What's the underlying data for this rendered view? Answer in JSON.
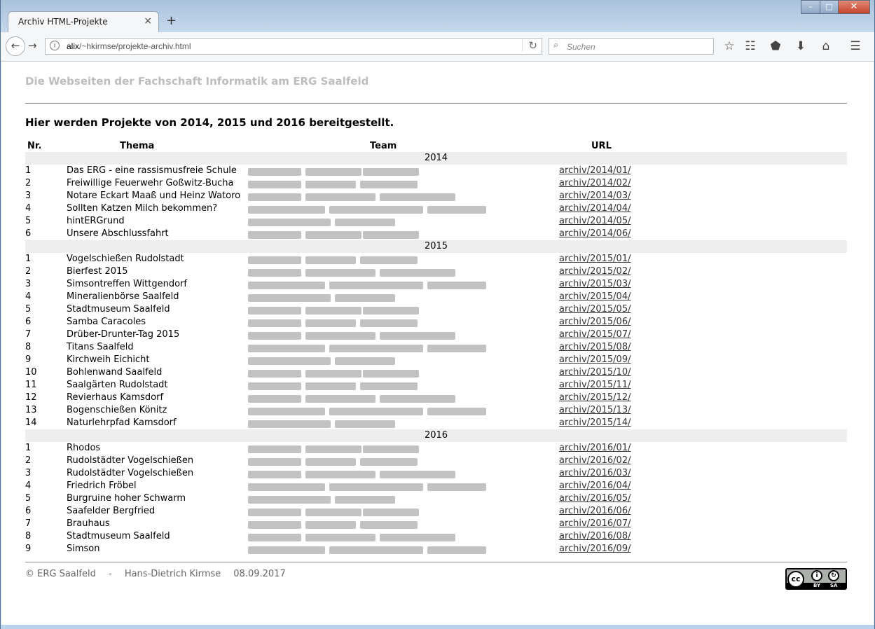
{
  "browser": {
    "tab_title": "Archiv HTML-Projekte",
    "tab_close": "×",
    "new_tab": "+",
    "url_host": "alix",
    "url_path": "/~hkirmse/projekte-archiv.html",
    "search_placeholder": "Suchen",
    "window_controls": {
      "minimize": "–",
      "maximize": "□",
      "close": "✕"
    },
    "toolbar_icons": [
      "bookmark-star-icon",
      "reader-view-icon",
      "pocket-icon",
      "downloads-icon",
      "home-icon",
      "menu-icon"
    ]
  },
  "page": {
    "site_title": "Die Webseiten der Fachschaft Informatik am ERG Saalfeld",
    "heading": "Hier werden Projekte von 2014, 2015 und 2016 bereitgestellt.",
    "columns": {
      "nr": "Nr.",
      "thema": "Thema",
      "team": "Team",
      "url": "URL"
    },
    "years": [
      {
        "year": "2014",
        "rows": [
          {
            "nr": "1",
            "thema": "Das ERG - eine rassismusfreie Schule",
            "url": "archiv/2014/01/"
          },
          {
            "nr": "2",
            "thema": "Freiwillige Feuerwehr Goßwitz-Bucha",
            "url": "archiv/2014/02/"
          },
          {
            "nr": "3",
            "thema": "Notare Eckart Maaß und Heinz Watoro",
            "url": "archiv/2014/03/"
          },
          {
            "nr": "4",
            "thema": "Sollten Katzen Milch bekommen?",
            "url": "archiv/2014/04/"
          },
          {
            "nr": "5",
            "thema": "hintERGrund",
            "url": "archiv/2014/05/"
          },
          {
            "nr": "6",
            "thema": "Unsere Abschlussfahrt",
            "url": "archiv/2014/06/"
          }
        ]
      },
      {
        "year": "2015",
        "rows": [
          {
            "nr": "1",
            "thema": "Vogelschießen Rudolstadt",
            "url": "archiv/2015/01/"
          },
          {
            "nr": "2",
            "thema": "Bierfest 2015",
            "url": "archiv/2015/02/"
          },
          {
            "nr": "3",
            "thema": "Simsontreffen Wittgendorf",
            "url": "archiv/2015/03/"
          },
          {
            "nr": "4",
            "thema": "Mineralienbörse Saalfeld",
            "url": "archiv/2015/04/"
          },
          {
            "nr": "5",
            "thema": "Stadtmuseum Saalfeld",
            "url": "archiv/2015/05/"
          },
          {
            "nr": "6",
            "thema": "Samba Caracoles",
            "url": "archiv/2015/06/"
          },
          {
            "nr": "7",
            "thema": "Drüber-Drunter-Tag 2015",
            "url": "archiv/2015/07/"
          },
          {
            "nr": "8",
            "thema": "Titans Saalfeld",
            "url": "archiv/2015/08/"
          },
          {
            "nr": "9",
            "thema": "Kirchweih Eichicht",
            "url": "archiv/2015/09/"
          },
          {
            "nr": "10",
            "thema": "Bohlenwand Saalfeld",
            "url": "archiv/2015/10/"
          },
          {
            "nr": "11",
            "thema": "Saalgärten Rudolstadt",
            "url": "archiv/2015/11/"
          },
          {
            "nr": "12",
            "thema": "Revierhaus Kamsdorf",
            "url": "archiv/2015/12/"
          },
          {
            "nr": "13",
            "thema": "Bogenschießen Könitz",
            "url": "archiv/2015/13/"
          },
          {
            "nr": "14",
            "thema": "Naturlehrpfad Kamsdorf",
            "url": "archiv/2015/14/"
          }
        ]
      },
      {
        "year": "2016",
        "rows": [
          {
            "nr": "1",
            "thema": "Rhodos",
            "url": "archiv/2016/01/"
          },
          {
            "nr": "2",
            "thema": "Rudolstädter Vogelschießen",
            "url": "archiv/2016/02/"
          },
          {
            "nr": "3",
            "thema": "Rudolstädter Vogelschießen",
            "url": "archiv/2016/03/"
          },
          {
            "nr": "4",
            "thema": "Friedrich Fröbel",
            "url": "archiv/2016/04/"
          },
          {
            "nr": "5",
            "thema": "Burgruine hoher Schwarm",
            "url": "archiv/2016/05/"
          },
          {
            "nr": "6",
            "thema": "Saafelder Bergfried",
            "url": "archiv/2016/06/"
          },
          {
            "nr": "7",
            "thema": "Brauhaus",
            "url": "archiv/2016/07/"
          },
          {
            "nr": "8",
            "thema": "Stadtmuseum Saalfeld",
            "url": "archiv/2016/08/"
          },
          {
            "nr": "9",
            "thema": "Simson",
            "url": "archiv/2016/09/"
          }
        ]
      }
    ],
    "footer": {
      "copyright": "© ERG Saalfeld",
      "separator": "-",
      "author": "Hans-Dietrich Kirmse",
      "date": "08.09.2017"
    },
    "license_badge": {
      "by": "BY",
      "sa": "SA"
    }
  }
}
